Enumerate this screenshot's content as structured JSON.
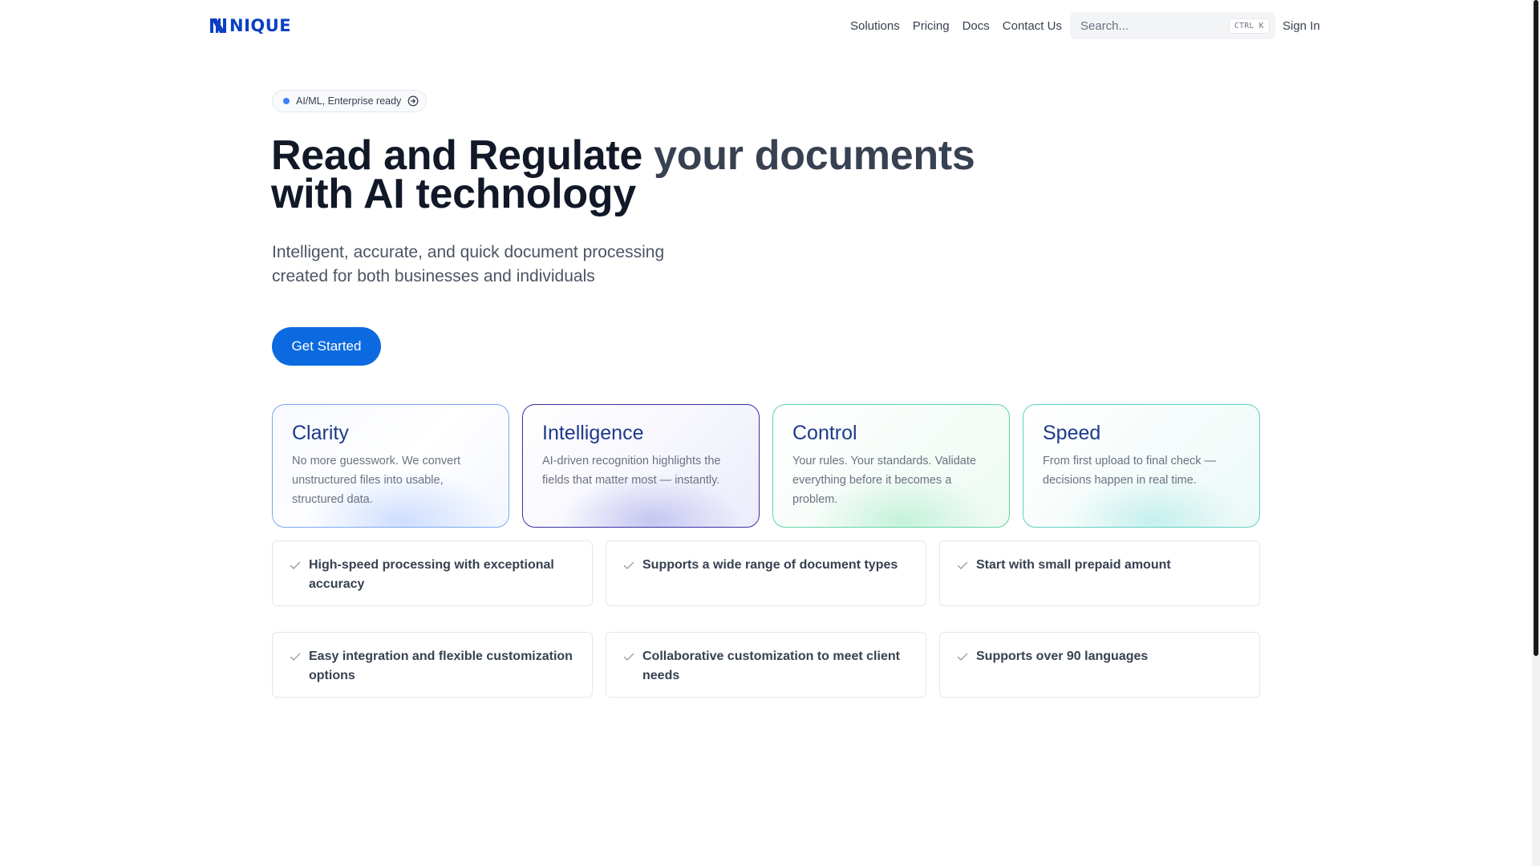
{
  "brand": {
    "name": "NIQUE",
    "logo_color": "#0b3fc4"
  },
  "nav": {
    "links": [
      "Solutions",
      "Pricing",
      "Docs",
      "Contact Us"
    ],
    "search_placeholder": "Search...",
    "search_shortcut": [
      "CTRL",
      "K"
    ],
    "sign_in": "Sign In"
  },
  "hero": {
    "badge": "AI/ML, Enterprise ready",
    "headline_line1_a": "Read and Regulate ",
    "headline_line1_b": "your documents",
    "headline_line2": "with AI technology",
    "subtitle": "Intelligent, accurate, and quick document processing created for both businesses and individuals",
    "cta": "Get Started",
    "accent": "#0b6ae0"
  },
  "cards": [
    {
      "title": "Clarity",
      "text": "No more guesswork. We convert unstructured files into usable, structured data."
    },
    {
      "title": "Intelligence",
      "text": "AI-driven recognition highlights the fields that matter most — instantly."
    },
    {
      "title": "Control",
      "text": "Your rules. Your standards. Validate everything before it becomes a problem."
    },
    {
      "title": "Speed",
      "text": "From first upload to final check — decisions happen in real time."
    }
  ],
  "features": [
    "High-speed processing with exceptional accuracy",
    "Supports a wide range of document types",
    "Start with small prepaid amount",
    "Easy integration and flexible customization options",
    "Collaborative customization to meet client needs",
    "Supports over 90 languages"
  ]
}
